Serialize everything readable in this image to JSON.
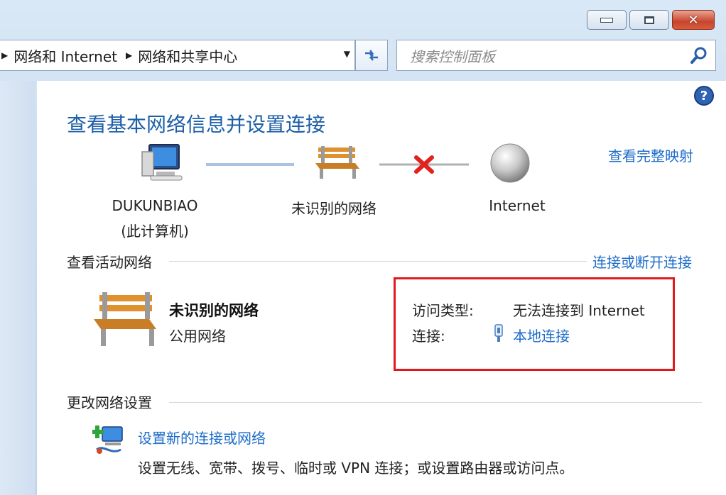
{
  "window": {
    "close_glyph": "✕"
  },
  "address_bar": {
    "crumbs": [
      "网络和 Internet",
      "网络和共享中心"
    ],
    "separator_glyph": "▶",
    "dropdown_glyph": "▼"
  },
  "search": {
    "placeholder": "搜索控制面板"
  },
  "content": {
    "title": "查看基本网络信息并设置连接",
    "full_map_link": "查看完整映射",
    "map": {
      "computer_name": "DUKUNBIAO",
      "computer_sub": "(此计算机)",
      "network_name": "未识别的网络",
      "internet_name": "Internet"
    },
    "active_networks": {
      "section_title": "查看活动网络",
      "connect_link": "连接或断开连接",
      "network_name": "未识别的网络",
      "network_type": "公用网络",
      "access_type_label": "访问类型:",
      "access_type_value": "无法连接到 Internet",
      "connection_label": "连接:",
      "connection_value": "本地连接"
    },
    "change_settings": {
      "section_title": "更改网络设置",
      "setup_link": "设置新的连接或网络",
      "setup_desc": "设置无线、宽带、拨号、临时或 VPN 连接；或设置路由器或访问点。"
    }
  },
  "colors": {
    "link": "#1d6cc9",
    "title": "#1d5fa8",
    "highlight": "#e0191e"
  }
}
